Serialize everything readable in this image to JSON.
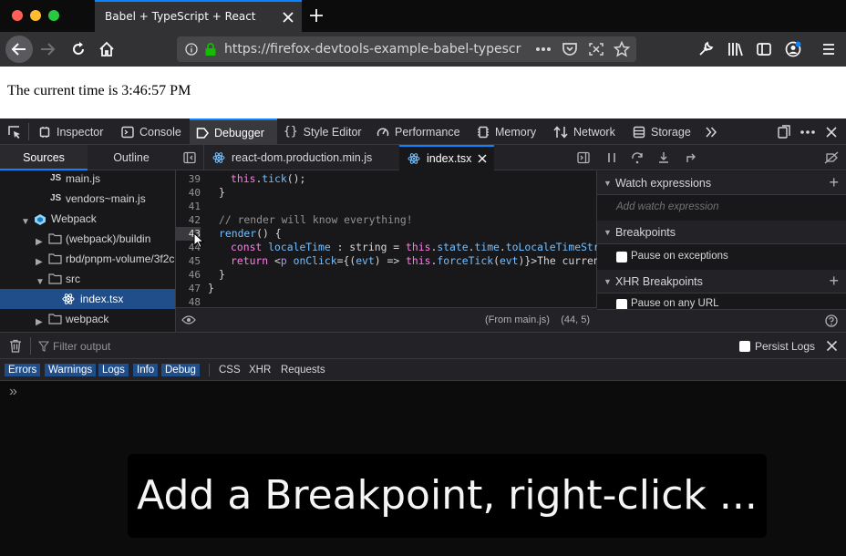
{
  "browser": {
    "tab_title": "Babel + TypeScript + React",
    "url": "https://firefox-devtools-example-babel-typescri"
  },
  "page": {
    "text": "The current time is 3:46:57 PM"
  },
  "devtools": {
    "tabs": [
      "Inspector",
      "Console",
      "Debugger",
      "Style Editor",
      "Performance",
      "Memory",
      "Network",
      "Storage"
    ],
    "active_tab": "Debugger"
  },
  "sources": {
    "tabs": [
      "Sources",
      "Outline"
    ],
    "tree": [
      "main.js",
      "vendors~main.js",
      "Webpack",
      "(webpack)/buildin",
      "rbd/pnpm-volume/3f2c",
      "src",
      "index.tsx",
      "webpack"
    ],
    "selected": "index.tsx"
  },
  "editor": {
    "tabs": [
      "react-dom.production.min.js",
      "index.tsx"
    ],
    "active_tab": "index.tsx",
    "line_numbers": [
      "39",
      "40",
      "41",
      "42",
      "43",
      "44",
      "45",
      "46",
      "47",
      "48"
    ],
    "footer_from": "(From main.js)",
    "footer_pos": "(44, 5)"
  },
  "right_panel": {
    "watch_title": "Watch expressions",
    "watch_placeholder": "Add watch expression",
    "breakpoints_title": "Breakpoints",
    "pause_exceptions": "Pause on exceptions",
    "xhr_title": "XHR Breakpoints",
    "pause_url": "Pause on any URL"
  },
  "console": {
    "filter_placeholder": "Filter output",
    "persist_logs": "Persist Logs",
    "filter_buttons_on": [
      "Errors",
      "Warnings",
      "Logs",
      "Info",
      "Debug"
    ],
    "filter_buttons_off": [
      "CSS",
      "XHR",
      "Requests"
    ],
    "prompt": "»"
  },
  "caption": "Add a Breakpoint, right-click ..."
}
